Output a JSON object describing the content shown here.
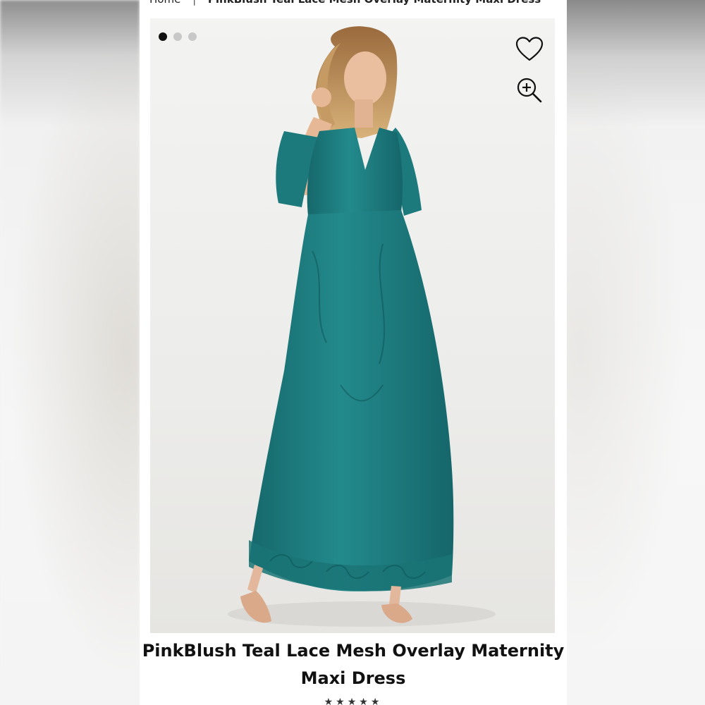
{
  "breadcrumb": {
    "home": "Home",
    "separator": "|",
    "current": "PinkBlush Teal Lace Mesh Overlay Maternity Maxi Dress"
  },
  "gallery": {
    "slide_count": 3,
    "active_slide": 1,
    "image_alt": "Model wearing teal lace mesh overlay maxi dress"
  },
  "icons": {
    "wishlist": "heart-icon",
    "zoom": "zoom-in-icon"
  },
  "product": {
    "title_line1": "PinkBlush Teal Lace Mesh Overlay Maternity",
    "title_line2": "Maxi Dress"
  },
  "rating": {
    "stars": "★★★★★"
  },
  "colors": {
    "dress": "#1f7f82",
    "dress_dark": "#15666a",
    "dots_active": "#111111",
    "dots_inactive": "#c8c8c8"
  }
}
